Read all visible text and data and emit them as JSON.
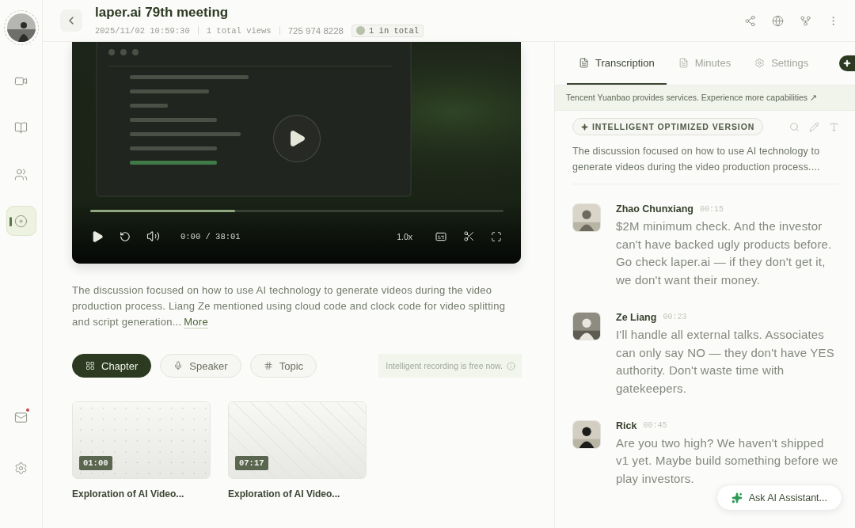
{
  "header": {
    "title": "laper.ai 79th meeting",
    "datetime": "2025/11/02 10:59:30",
    "views": "1 total views",
    "meeting_id": "725 974 8228",
    "participants": "1 in total"
  },
  "sidebar": {
    "items": [
      {
        "kind": "video",
        "selected": false
      },
      {
        "kind": "book",
        "selected": false
      },
      {
        "kind": "people",
        "selected": false
      },
      {
        "kind": "record",
        "selected": true
      }
    ],
    "bottom": [
      {
        "kind": "mail",
        "unread": true
      },
      {
        "kind": "settings"
      }
    ]
  },
  "player": {
    "progress": {
      "level": 0.35
    },
    "time": "0:00 / 38:01",
    "speed": "1.0x"
  },
  "summary": {
    "text": "The discussion focused on how to use AI technology to generate videos during the video production process. Liang Ze mentioned using cloud code and clock code for video splitting and script generation...",
    "more": "More"
  },
  "view_tabs": [
    {
      "label": "Chapter",
      "kind": "grid",
      "selected": true
    },
    {
      "label": "Speaker",
      "kind": "mic",
      "selected": false
    },
    {
      "label": "Topic",
      "kind": "hash",
      "selected": false
    }
  ],
  "notice": "Intelligent recording is free now.",
  "chapters": [
    {
      "duration": "01:00",
      "title": "Exploration of AI Video...",
      "kind": "dots"
    },
    {
      "duration": "07:17",
      "title": "Exploration of AI Video...",
      "kind": "lines"
    }
  ],
  "panel": {
    "tabs": [
      {
        "label": "Transcription",
        "kind": "doc",
        "selected": true
      },
      {
        "label": "Minutes",
        "kind": "doc",
        "selected": false
      },
      {
        "label": "Settings",
        "kind": "gear",
        "selected": false
      }
    ],
    "banner": "Tencent Yuanbao provides services. Experience more capabilities ↗",
    "version_badge": "INTELLIGENT OPTIMIZED VERSION",
    "summary": "The discussion focused on how to use AI technology to generate videos during the video production process....",
    "entries": [
      {
        "speaker": "Zhao Chunxiang",
        "time": "00:15",
        "text": "$2M minimum check. And the investor can't have backed ugly products before. Go check laper.ai — if they don't get it, we don't want their money."
      },
      {
        "speaker": "Ze Liang",
        "time": "00:23",
        "text": "I'll handle all external talks. Associates can only say NO — they don't have YES authority. Don't waste time with gatekeepers."
      },
      {
        "speaker": "Rick",
        "time": "00:45",
        "text": "Are you two high? We haven't shipped v1 yet. Maybe build something before we play investors."
      }
    ],
    "assistant_button": "Ask AI Assistant..."
  }
}
